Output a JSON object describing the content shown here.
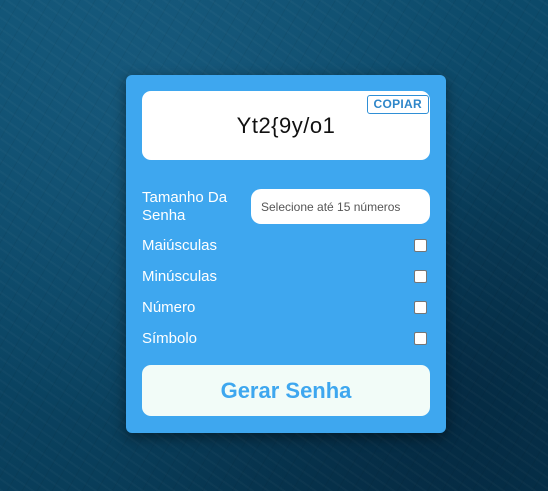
{
  "generator": {
    "password": "Yt2{9y/o1",
    "copy_label": "COPIAR",
    "length": {
      "label": "Tamanho Da Senha",
      "value": "",
      "placeholder": "Selecione até 15 números"
    },
    "options": [
      {
        "label": "Maiúsculas",
        "checked": false
      },
      {
        "label": "Minúsculas",
        "checked": false
      },
      {
        "label": "Número",
        "checked": false
      },
      {
        "label": "Símbolo",
        "checked": false
      }
    ],
    "generate_label": "Gerar Senha"
  },
  "colors": {
    "card": "#3ea7ef",
    "button_bg": "#f2fcf8",
    "button_text": "#3ea7ef",
    "background": "#0b4665"
  }
}
